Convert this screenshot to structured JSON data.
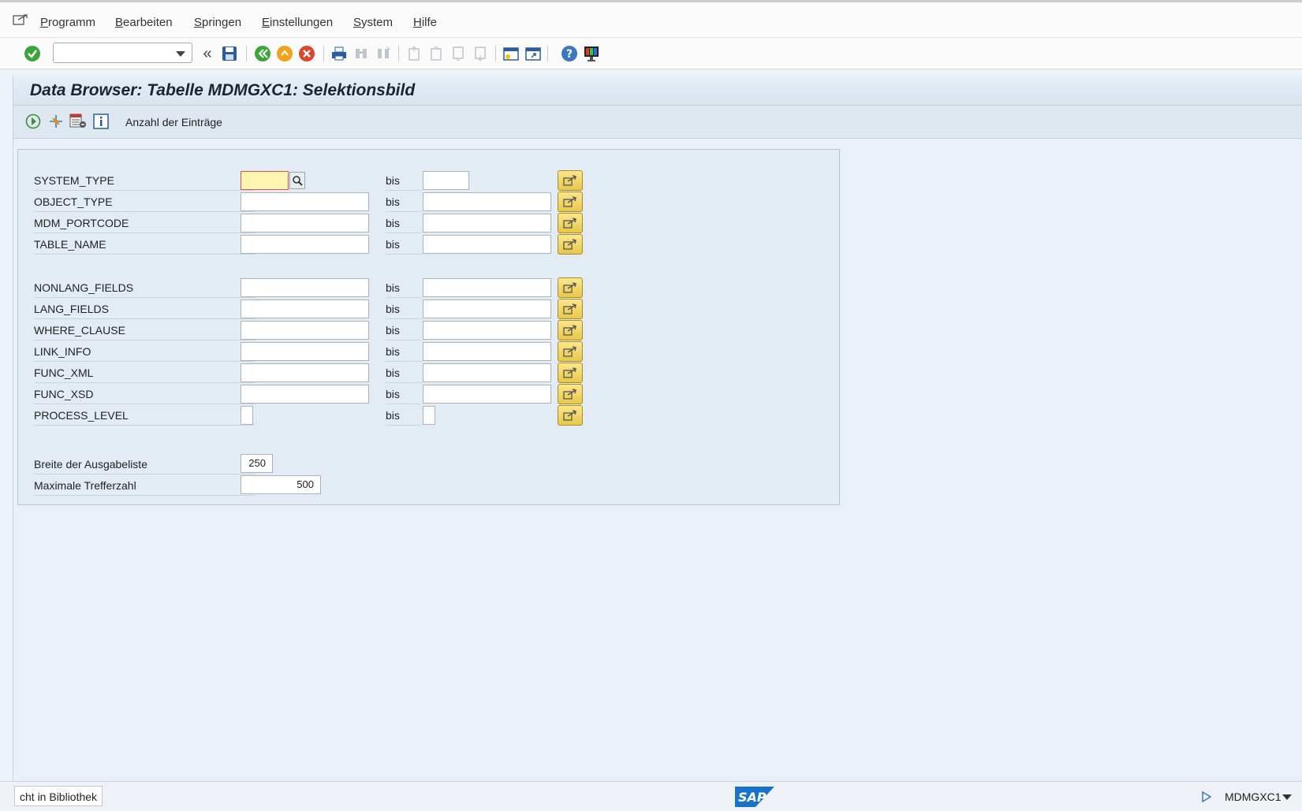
{
  "menu": {
    "items": [
      "Programm",
      "Bearbeiten",
      "Springen",
      "Einstellungen",
      "System",
      "Hilfe"
    ]
  },
  "toolbar": {
    "command_field_value": ""
  },
  "title": "Data Browser: Tabelle MDMGXC1: Selektionsbild",
  "app_toolbar": {
    "count_label": "Anzahl der Einträge"
  },
  "selection": {
    "bis_label": "bis",
    "rows": [
      {
        "label": "SYSTEM_TYPE",
        "from": "",
        "to": ""
      },
      {
        "label": "OBJECT_TYPE",
        "from": "",
        "to": ""
      },
      {
        "label": "MDM_PORTCODE",
        "from": "",
        "to": ""
      },
      {
        "label": "TABLE_NAME",
        "from": "",
        "to": ""
      },
      {
        "label": "NONLANG_FIELDS",
        "from": "",
        "to": ""
      },
      {
        "label": "LANG_FIELDS",
        "from": "",
        "to": ""
      },
      {
        "label": "WHERE_CLAUSE",
        "from": "",
        "to": ""
      },
      {
        "label": "LINK_INFO",
        "from": "",
        "to": ""
      },
      {
        "label": "FUNC_XML",
        "from": "",
        "to": ""
      },
      {
        "label": "FUNC_XSD",
        "from": "",
        "to": ""
      },
      {
        "label": "PROCESS_LEVEL",
        "from": "",
        "to": ""
      }
    ],
    "width_label": "Breite der Ausgabeliste",
    "width_value": "250",
    "max_label": "Maximale Trefferzahl",
    "max_value": "500"
  },
  "status": {
    "left_text": "cht in Bibliothek",
    "logo_text": "SAP",
    "system": "MDMGXC1"
  },
  "colors": {
    "accent_yellow": "#f2d45c",
    "focus_field": "#fff4b0",
    "title_bg": "#dfe8f1"
  }
}
